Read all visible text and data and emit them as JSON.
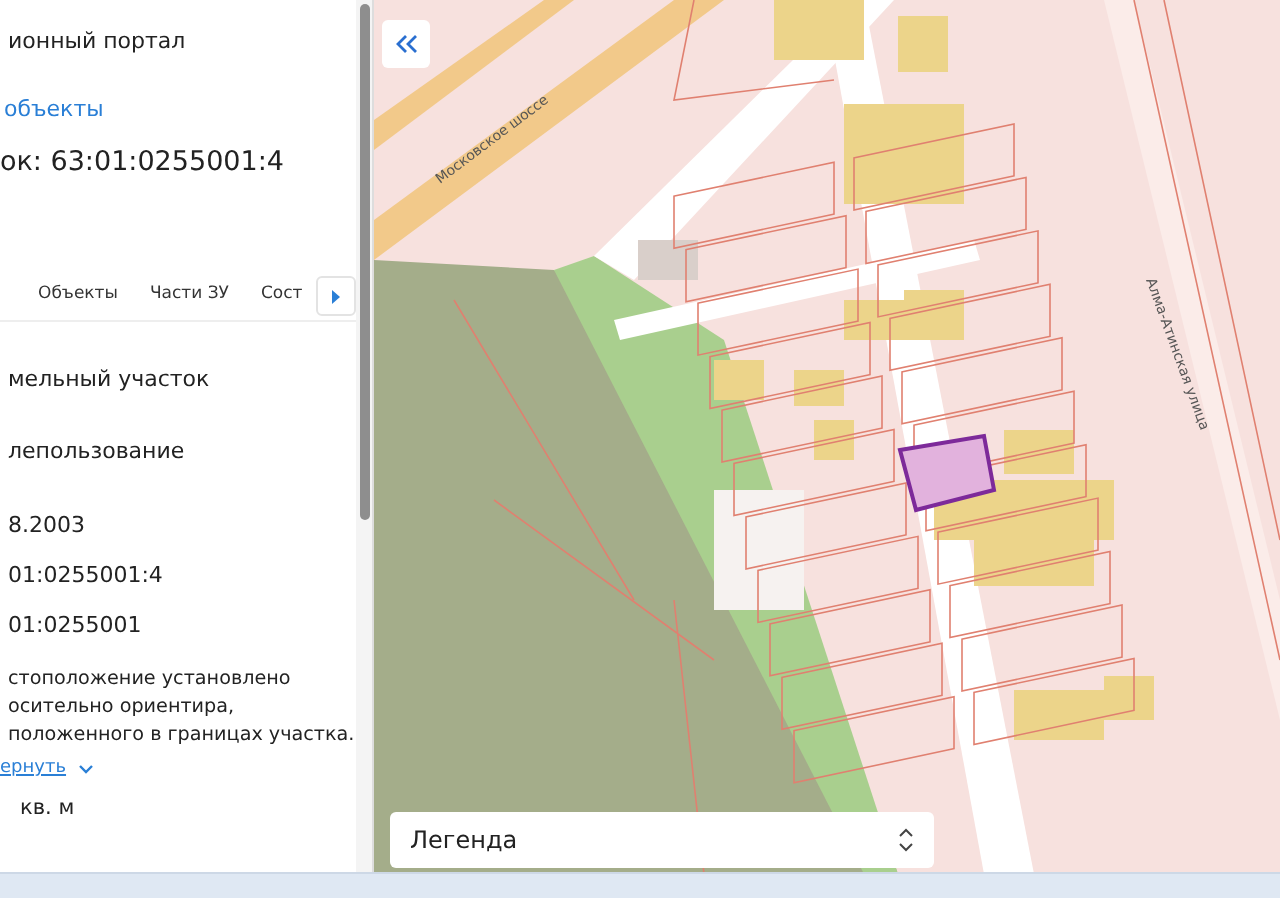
{
  "panel": {
    "title": "ионный портал",
    "back_link": "объекты",
    "heading": "ок: 63:01:0255001:4",
    "tabs": [
      {
        "label": "Объекты",
        "selected": false
      },
      {
        "label": "Части ЗУ",
        "selected": false
      },
      {
        "label": "Сост",
        "selected": false
      }
    ],
    "fields": [
      {
        "value": "мельный участок"
      },
      {
        "value": "лепользование"
      },
      {
        "value": "8.2003"
      },
      {
        "value": "01:0255001:4"
      },
      {
        "value": "01:0255001"
      },
      {
        "lines": [
          "стоположение установлено",
          "осительно ориентира,",
          "положенного в границах участка."
        ]
      }
    ],
    "collapse_link": "ернуть",
    "area": "кв. м"
  },
  "map": {
    "labels": [
      {
        "text": "Московское шоссе",
        "kind": "road"
      },
      {
        "text": "Алма-Атинская улица",
        "kind": "street"
      }
    ],
    "legend": {
      "label": "Легенда"
    }
  }
}
